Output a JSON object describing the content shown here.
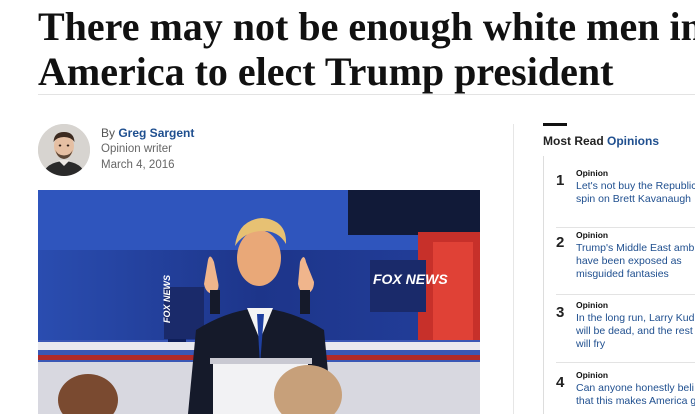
{
  "article": {
    "headline_line1": "There may not be enough white men in",
    "headline_line2": "America to elect Trump president",
    "byline_prefix": "By ",
    "author": "Greg Sargent",
    "author_role": "Opinion writer",
    "date": "March 4, 2016",
    "photo": {
      "alt": "Donald Trump at a debate podium raising both hands",
      "sign_text_1": "FOX NEWS",
      "sign_text_2": "FOX NEWS"
    }
  },
  "sidebar": {
    "heading_prefix": "Most Read ",
    "heading_accent": "Opinions",
    "items": [
      {
        "number": "1",
        "kicker": "Opinion",
        "title": "Let's not buy the Republic spin on Brett Kavanaugh"
      },
      {
        "number": "2",
        "kicker": "Opinion",
        "title": "Trump's Middle East amb have been exposed as misguided fantasies"
      },
      {
        "number": "3",
        "kicker": "Opinion",
        "title": "In the long run, Larry Kud will be dead, and the rest will fry"
      },
      {
        "number": "4",
        "kicker": "Opinion",
        "title": "Can anyone honestly beli that this makes America g"
      }
    ]
  },
  "colors": {
    "link_blue": "#1f4f8f",
    "rule_gray": "#e3e3e3",
    "stage_blue": "#1f3f96"
  }
}
